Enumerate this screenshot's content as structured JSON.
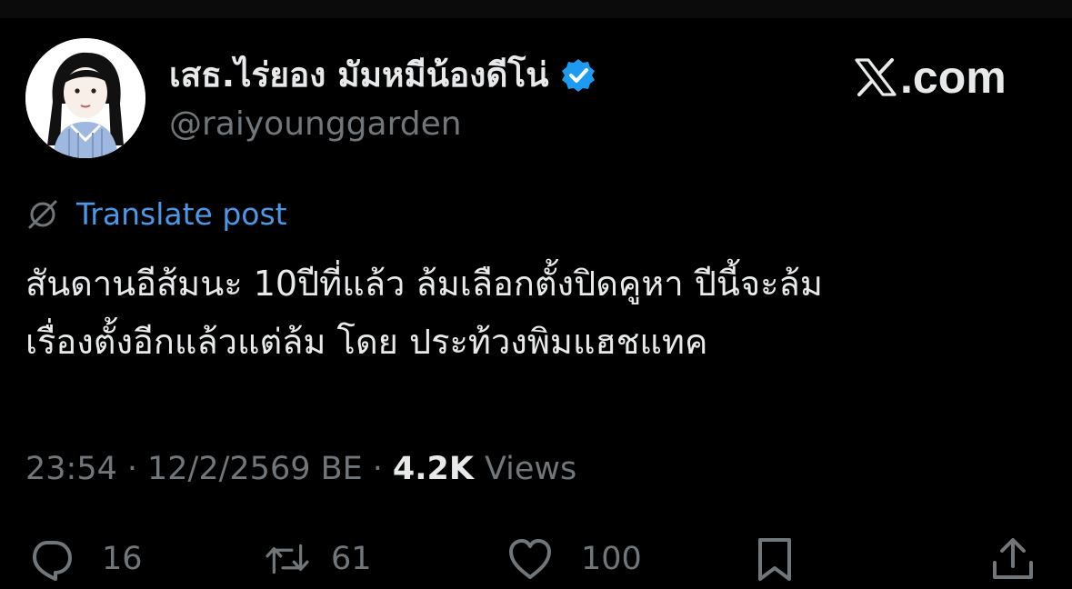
{
  "author": {
    "display_name": "เสธ.ไร่ยอง มัมหมีน้องดีโน่",
    "handle": "@raiyounggarden",
    "verified": true
  },
  "brand": {
    "text": ".com",
    "icon": "x-logo-icon"
  },
  "translate": {
    "label": "Translate post",
    "icon": "globe-slash-icon"
  },
  "post": {
    "text": "สันดานอีส้มนะ 10ปีที่แล้ว ล้มเลือกตั้งปิดคูหา  ปีนี้จะล้ม\nเรื่องตั้งอีกแล้วแต่ล้ม โดย ประท้วงพิมแฮชแทค"
  },
  "meta": {
    "time": "23:54",
    "separator": "·",
    "date": "12/2/2569 BE",
    "views_count": "4.2K",
    "views_label": "Views"
  },
  "actions": {
    "replies": {
      "icon": "reply-icon",
      "count": "16"
    },
    "reposts": {
      "icon": "repost-icon",
      "count": "61"
    },
    "likes": {
      "icon": "heart-icon",
      "count": "100"
    },
    "bookmark": {
      "icon": "bookmark-icon"
    },
    "share": {
      "icon": "share-icon"
    }
  },
  "colors": {
    "background": "#000000",
    "text": "#e7e9ea",
    "muted": "#71767b",
    "link": "#4a99e9",
    "verified": "#1d9bf0"
  }
}
